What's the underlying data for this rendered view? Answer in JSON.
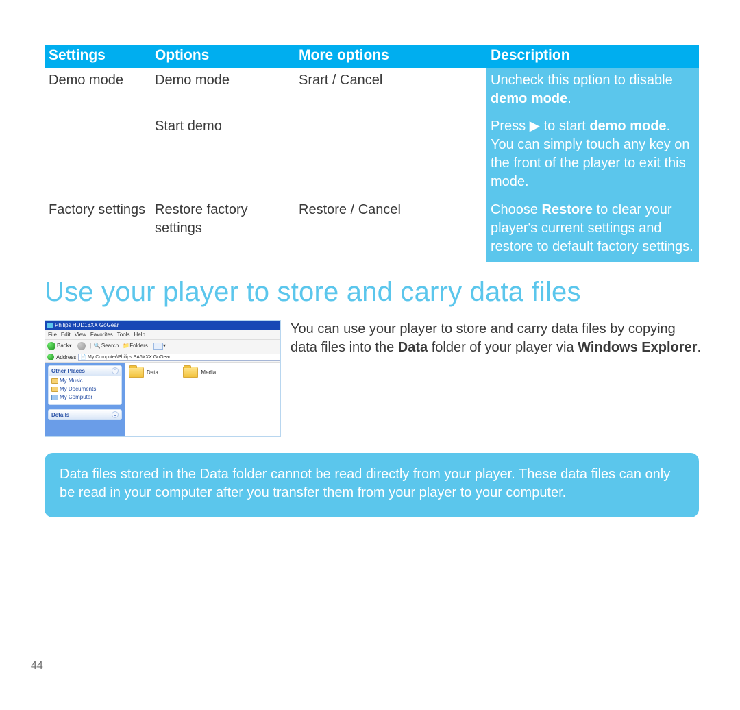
{
  "table": {
    "headers": [
      "Settings",
      "Options",
      "More options",
      "Description"
    ],
    "rows": [
      {
        "settings": "Demo mode",
        "options": "Demo mode",
        "more": "Srart / Cancel",
        "desc": {
          "pre": "Uncheck this option to disable ",
          "b": "demo mode",
          "post": "."
        }
      },
      {
        "settings": "",
        "options": "Start demo",
        "more": "",
        "desc": {
          "pre": "Press ▶ to start ",
          "b": "demo mode",
          "post": ". You can simply touch any key on the front of the player to exit this mode."
        }
      },
      {
        "settings": "Factory settings",
        "options": "Restore factory settings",
        "more": "Restore / Cancel",
        "desc": {
          "pre": "Choose ",
          "b": "Restore",
          "post": " to clear your player's current settings and restore to default factory settings."
        }
      }
    ]
  },
  "heading": "Use your player to store and carry data files",
  "thumb": {
    "title": "Philips HDD18XX GoGear",
    "menus": [
      "File",
      "Edit",
      "View",
      "Favorites",
      "Tools",
      "Help"
    ],
    "back": "Back",
    "search": "Search",
    "folders": "Folders",
    "address_label": "Address",
    "address_value": "My Computer\\Philips SA6XXX GoGear",
    "side": {
      "other_places": "Other Places",
      "my_music": "My Music",
      "my_documents": "My Documents",
      "my_computer": "My Computer",
      "details": "Details"
    },
    "folder1": "Data",
    "folder2": "Media"
  },
  "copy": {
    "pre": "You can use your player to store and carry data files by copying data files into the ",
    "b1": "Data",
    "mid": " folder of your player via ",
    "b2": "Windows Explorer",
    "post": "."
  },
  "note": "Data files stored in the Data folder cannot be read directly from your player. These data files can only be read in your computer after you transfer them from your player to your computer.",
  "pagenum": "44"
}
